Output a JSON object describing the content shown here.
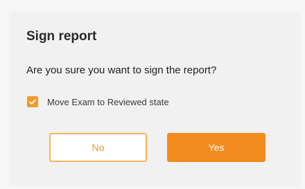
{
  "dialog": {
    "title": "Sign report",
    "message": "Are you sure you want to sign the report?",
    "checkbox": {
      "label": "Move Exam to Reviewed state",
      "checked": true
    },
    "buttons": {
      "no_label": "No",
      "yes_label": "Yes"
    }
  },
  "colors": {
    "accent": "#f28c1e",
    "accent_border": "#f4b55c",
    "dialog_background": "#f1f1f1"
  }
}
